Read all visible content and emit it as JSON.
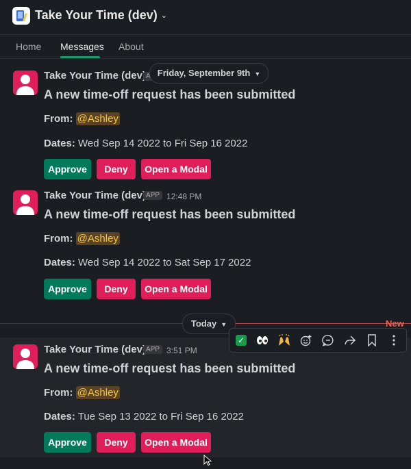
{
  "header": {
    "title": "Take Your Time (dev)",
    "chevron": "⌄"
  },
  "tabs": [
    {
      "label": "Home",
      "active": false
    },
    {
      "label": "Messages",
      "active": true
    },
    {
      "label": "About",
      "active": false
    }
  ],
  "date_dividers": {
    "first": "Friday, September 9th",
    "second": "Today"
  },
  "new_label": "New",
  "messages": [
    {
      "sender": "Take Your Time (dev)",
      "badge": "A",
      "time": "",
      "title": "A new time-off request has been submitted",
      "from_label": "From:",
      "mention": "@Ashley",
      "dates_label": "Dates:",
      "dates_value": "Wed Sep 14 2022 to Fri Sep 16 2022",
      "buttons": {
        "approve": "Approve",
        "deny": "Deny",
        "modal": "Open a Modal"
      }
    },
    {
      "sender": "Take Your Time (dev)",
      "badge": "APP",
      "time": "12:48 PM",
      "title": "A new time-off request has been submitted",
      "from_label": "From:",
      "mention": "@Ashley",
      "dates_label": "Dates:",
      "dates_value": "Wed Sep 14 2022 to Sat Sep 17 2022",
      "buttons": {
        "approve": "Approve",
        "deny": "Deny",
        "modal": "Open a Modal"
      }
    },
    {
      "sender": "Take Your Time (dev)",
      "badge": "APP",
      "time": "3:51 PM",
      "title": "A new time-off request has been submitted",
      "from_label": "From:",
      "mention": "@Ashley",
      "dates_label": "Dates:",
      "dates_value": "Tue Sep 13 2022 to Fri Sep 16 2022",
      "buttons": {
        "approve": "Approve",
        "deny": "Deny",
        "modal": "Open a Modal"
      }
    }
  ],
  "toolbar": {
    "icons": [
      "white-check-mark-icon",
      "eyes-icon",
      "raised-hands-icon",
      "add-reaction-icon",
      "reply-in-thread-icon",
      "share-icon",
      "bookmark-icon",
      "more-actions-icon"
    ]
  },
  "colors": {
    "background": "#1a1d21",
    "approve": "#007a5a",
    "deny": "#e01e5a",
    "mention_bg": "#5b4222",
    "mention_text": "#f2c744",
    "new_divider": "#e0655c"
  }
}
